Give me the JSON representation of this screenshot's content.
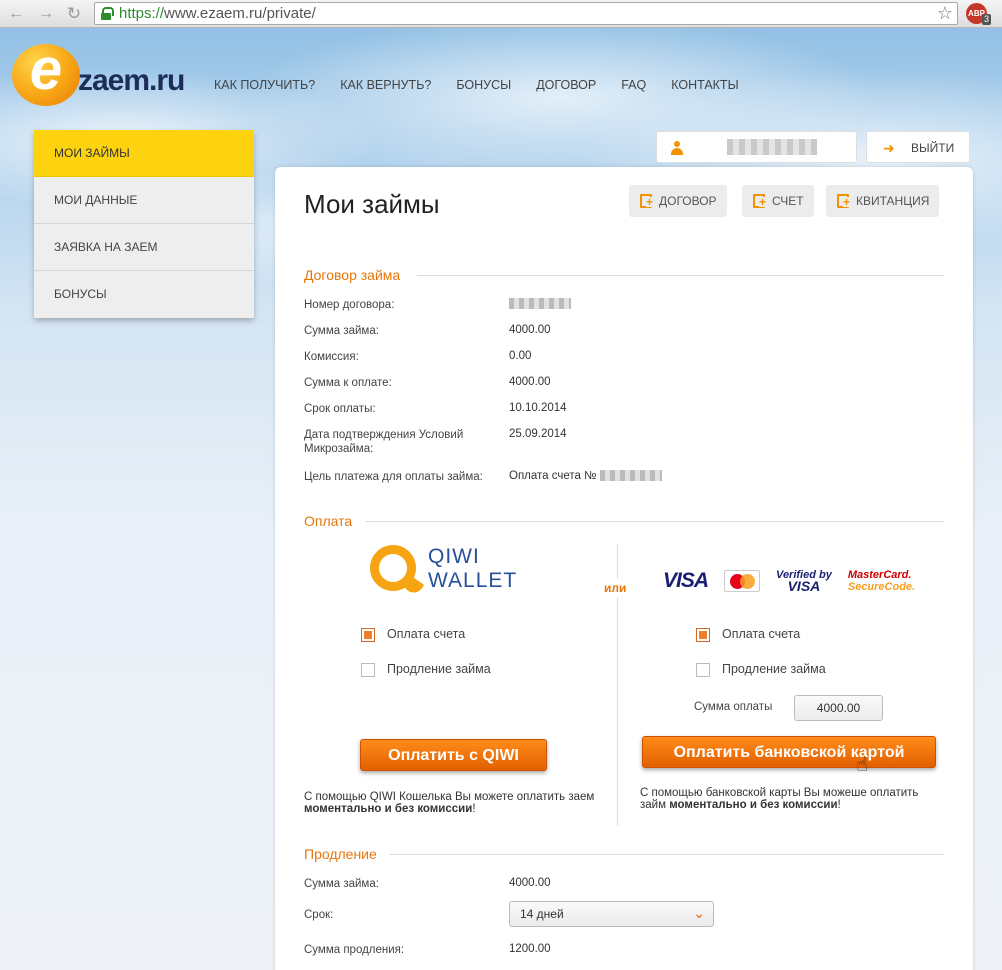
{
  "browser": {
    "url_scheme": "https://",
    "url_rest": "www.ezaem.ru/private/",
    "abp_label": "ABP",
    "abp_count": "3"
  },
  "logo": {
    "letter": "e",
    "text": "zaem.ru"
  },
  "topnav": [
    "КАК ПОЛУЧИТЬ?",
    "КАК ВЕРНУТЬ?",
    "БОНУСЫ",
    "ДОГОВОР",
    "FAQ",
    "КОНТАКТЫ"
  ],
  "sidebar": [
    "МОИ ЗАЙМЫ",
    "МОИ ДАННЫЕ",
    "ЗАЯВКА НА ЗАЕМ",
    "БОНУСЫ"
  ],
  "user": {
    "logout_label": "ВЫЙТИ"
  },
  "page": {
    "title": "Мои займы",
    "doc_buttons": [
      "ДОГОВОР",
      "СЧЕТ",
      "КВИТАНЦИЯ"
    ]
  },
  "contract": {
    "title": "Договор займа",
    "rows": [
      {
        "label": "Номер договора:",
        "value": ""
      },
      {
        "label": "Сумма займа:",
        "value": "4000.00"
      },
      {
        "label": "Комиссия:",
        "value": "0.00"
      },
      {
        "label": "Сумма к оплате:",
        "value": "4000.00"
      },
      {
        "label": "Срок оплаты:",
        "value": "10.10.2014"
      },
      {
        "label": "Дата подтверждения Условий Микрозайма:",
        "value": "25.09.2014"
      },
      {
        "label": "Цель платежа для оплаты займа:",
        "value": "Оплата счета №"
      }
    ]
  },
  "payment": {
    "title": "Оплата",
    "qiwi_line1": "QIWI",
    "qiwi_line2": "WALLET",
    "or_label": "или",
    "cards": {
      "visa": "VISA",
      "verified_by": "Verified by",
      "verified_visa": "VISA",
      "mc_sc_line1": "MasterCard.",
      "mc_sc_line2": "SecureCode."
    },
    "qiwi": {
      "opt_invoice": "Оплата счета",
      "opt_extend": "Продление займа",
      "button": "Оплатить с QIWI",
      "note_prefix": "С помощью QIWI Кошелька Вы можете оплатить заем ",
      "note_bold": "моментально и без комиссии",
      "note_suffix": "!"
    },
    "card": {
      "opt_invoice": "Оплата счета",
      "opt_extend": "Продление займа",
      "sum_label": "Сумма оплаты",
      "sum_value": "4000.00",
      "button": "Оплатить банковской картой",
      "note_prefix": "С помощью банковской карты Вы можеше оплатить займ ",
      "note_bold": "моментально и без комиссии",
      "note_suffix": "!"
    }
  },
  "extension": {
    "title": "Продление",
    "loan_label": "Сумма займа:",
    "loan_value": "4000.00",
    "term_label": "Срок:",
    "term_value": "14 дней",
    "sum_label": "Сумма продления:",
    "sum_value": "1200.00"
  },
  "colors": {
    "accent": "#e8760b",
    "sidebar_active": "#fdd20f",
    "button": "#f07d2a"
  }
}
